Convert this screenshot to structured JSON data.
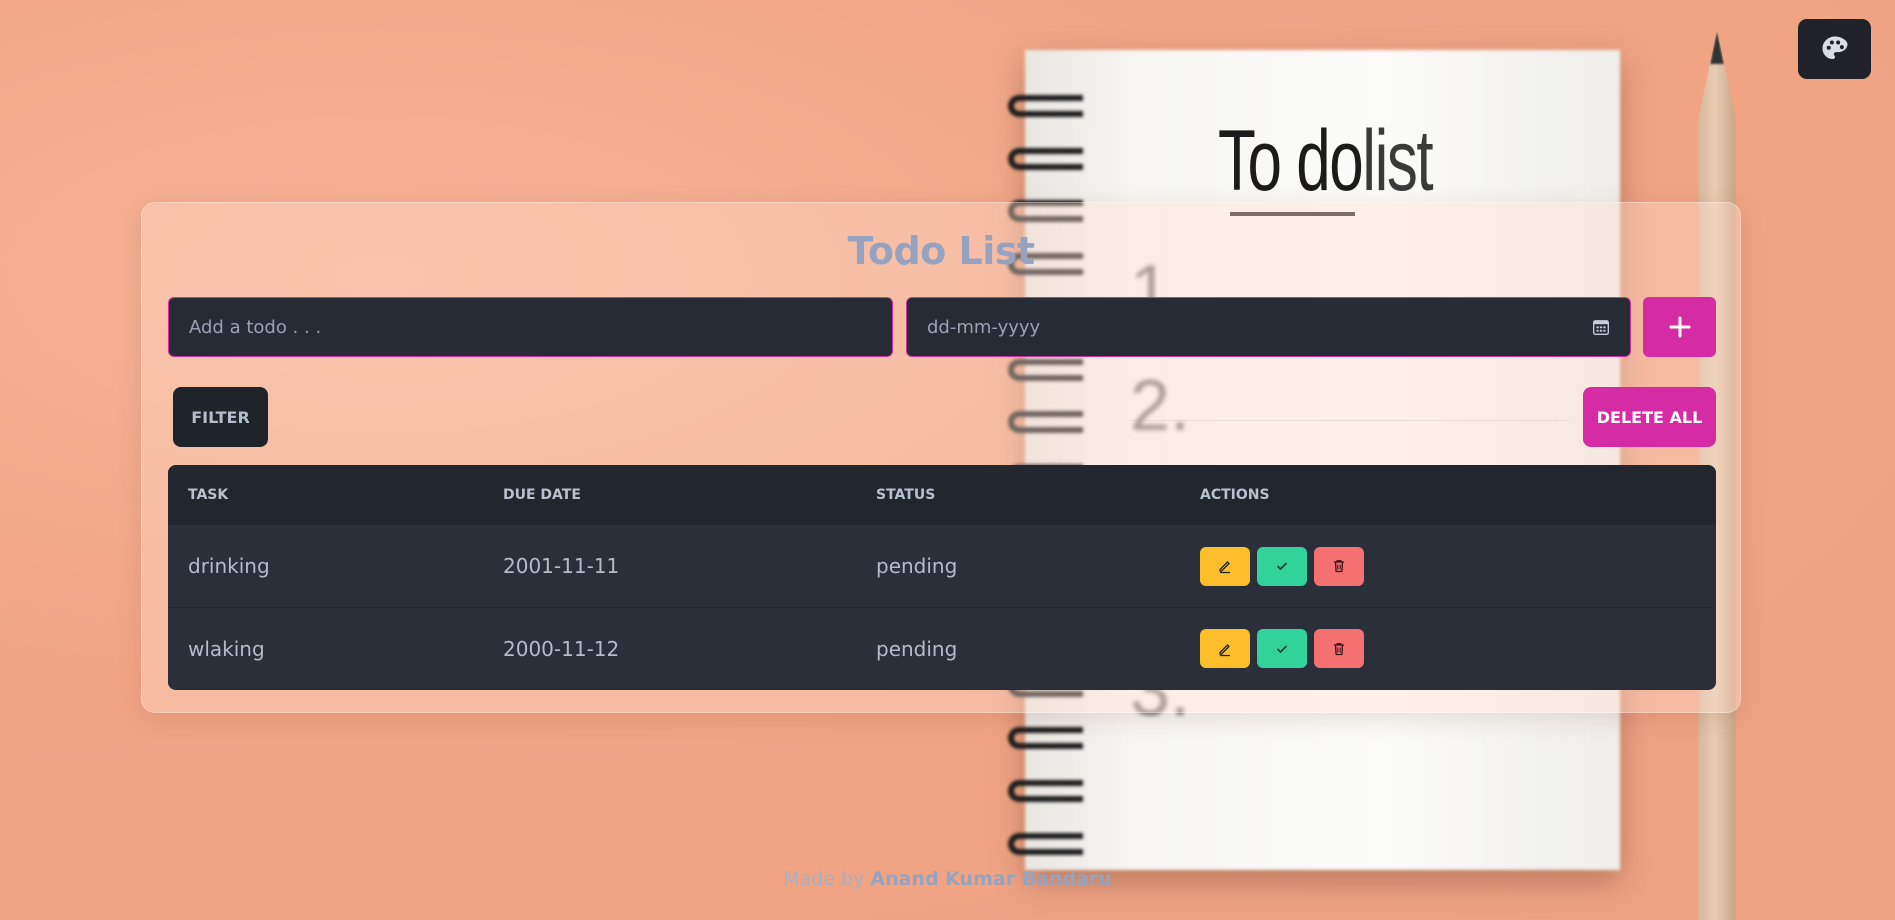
{
  "theme_toggle": {
    "icon": "palette-icon"
  },
  "app": {
    "title": "Todo List"
  },
  "form": {
    "todo_placeholder": "Add a todo . . .",
    "date_placeholder": "dd-mm-yyyy",
    "add_icon": "plus-icon"
  },
  "toolbar": {
    "filter_label": "FILTER",
    "delete_all_label": "DELETE ALL"
  },
  "table": {
    "headers": {
      "task": "TASK",
      "due_date": "DUE DATE",
      "status": "STATUS",
      "actions": "ACTIONS"
    },
    "rows": [
      {
        "task": "drinking",
        "due_date": "2001-11-11",
        "status": "pending"
      },
      {
        "task": "wlaking",
        "due_date": "2000-11-12",
        "status": "pending"
      }
    ]
  },
  "footer": {
    "prefix": "Made by",
    "author": "Anand Kumar Bandaru"
  },
  "background": {
    "heading_bold": "To do",
    "heading_thin": "list",
    "numbers": [
      "1.",
      "2.",
      "3."
    ]
  },
  "colors": {
    "accent": "#d52ca6",
    "dark": "#262b35",
    "edit": "#fcbf2b",
    "done": "#32d39a",
    "delete": "#f57171",
    "title": "#95a3c0"
  }
}
